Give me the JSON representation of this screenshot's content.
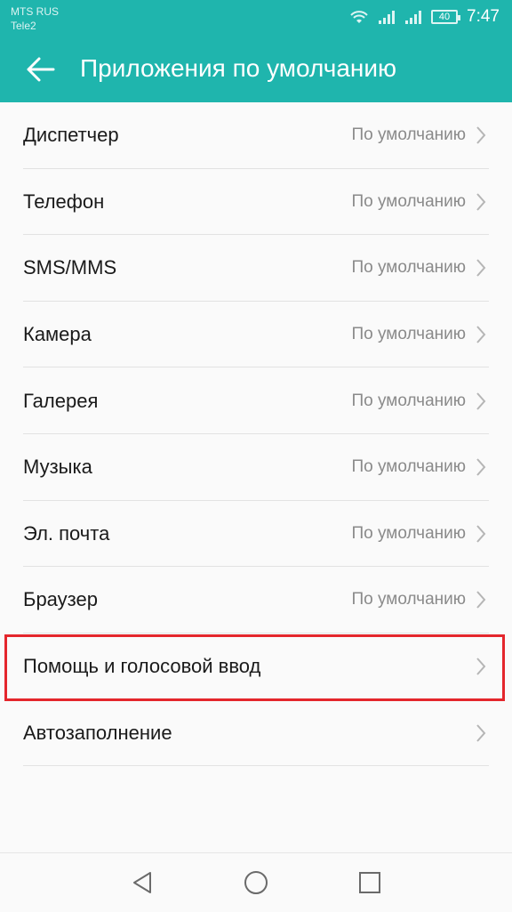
{
  "status_bar": {
    "carrier1": "MTS RUS",
    "carrier2": "Tele2",
    "battery": "40",
    "time": "7:47"
  },
  "header": {
    "title": "Приложения по умолчанию",
    "back_icon": "arrow-left-icon"
  },
  "colors": {
    "accent": "#1fb5ad",
    "highlight_box": "#e4262c"
  },
  "items": [
    {
      "label": "Диспетчер",
      "value": "По умолчанию"
    },
    {
      "label": "Телефон",
      "value": "По умолчанию"
    },
    {
      "label": "SMS/MMS",
      "value": "По умолчанию"
    },
    {
      "label": "Камера",
      "value": "По умолчанию"
    },
    {
      "label": "Галерея",
      "value": "По умолчанию"
    },
    {
      "label": "Музыка",
      "value": "По умолчанию"
    },
    {
      "label": "Эл. почта",
      "value": "По умолчанию"
    },
    {
      "label": "Браузер",
      "value": "По умолчанию"
    },
    {
      "label": "Помощь и голосовой ввод",
      "value": ""
    },
    {
      "label": "Автозаполнение",
      "value": ""
    }
  ],
  "nav": {
    "back": "triangle-back-icon",
    "home": "circle-home-icon",
    "recents": "square-recents-icon"
  }
}
